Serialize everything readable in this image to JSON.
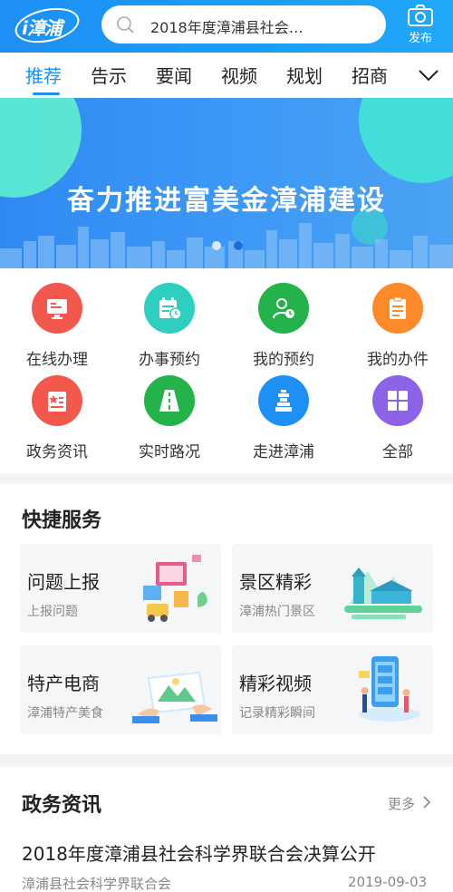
{
  "header": {
    "logo_text": "i漳浦",
    "search_text": "2018年度漳浦县社会…",
    "publish_label": "发布"
  },
  "tabs": {
    "items": [
      "推荐",
      "告示",
      "要闻",
      "视频",
      "规划",
      "招商"
    ],
    "active_index": 0
  },
  "banner": {
    "headline": "奋力推进富美金漳浦建设",
    "slide_count": 2,
    "active_slide": 1
  },
  "services": [
    {
      "label": "在线办理",
      "icon": "online-handling-icon",
      "color": "#f2584b"
    },
    {
      "label": "办事预约",
      "icon": "appointment-icon",
      "color": "#2ecfc1"
    },
    {
      "label": "我的预约",
      "icon": "my-appointment-icon",
      "color": "#24b34a"
    },
    {
      "label": "我的办件",
      "icon": "my-files-icon",
      "color": "#ff8a2a"
    },
    {
      "label": "政务资讯",
      "icon": "gov-news-icon",
      "color": "#f2584b"
    },
    {
      "label": "实时路况",
      "icon": "traffic-icon",
      "color": "#24b34a"
    },
    {
      "label": "走进漳浦",
      "icon": "tower-icon",
      "color": "#1e8ff5"
    },
    {
      "label": "全部",
      "icon": "all-grid-icon",
      "color": "#8c63e6"
    }
  ],
  "quick_services": {
    "title": "快捷服务",
    "cards": [
      {
        "name": "问题上报",
        "sub": "上报问题",
        "art": "report-illustration"
      },
      {
        "name": "景区精彩",
        "sub": "漳浦热门景区",
        "art": "scenery-illustration"
      },
      {
        "name": "特产电商",
        "sub": "漳浦特产美食",
        "art": "ecommerce-illustration"
      },
      {
        "name": "精彩视频",
        "sub": "记录精彩瞬间",
        "art": "video-illustration"
      }
    ]
  },
  "news": {
    "title": "政务资讯",
    "more_label": "更多",
    "items": [
      {
        "headline": "2018年度漳浦县社会科学界联合会决算公开",
        "source": "漳浦县社会科学界联合会",
        "date": "2019-09-03"
      }
    ]
  },
  "colors": {
    "brand": "#1e8ff5",
    "text": "#222222",
    "muted": "#888888"
  }
}
